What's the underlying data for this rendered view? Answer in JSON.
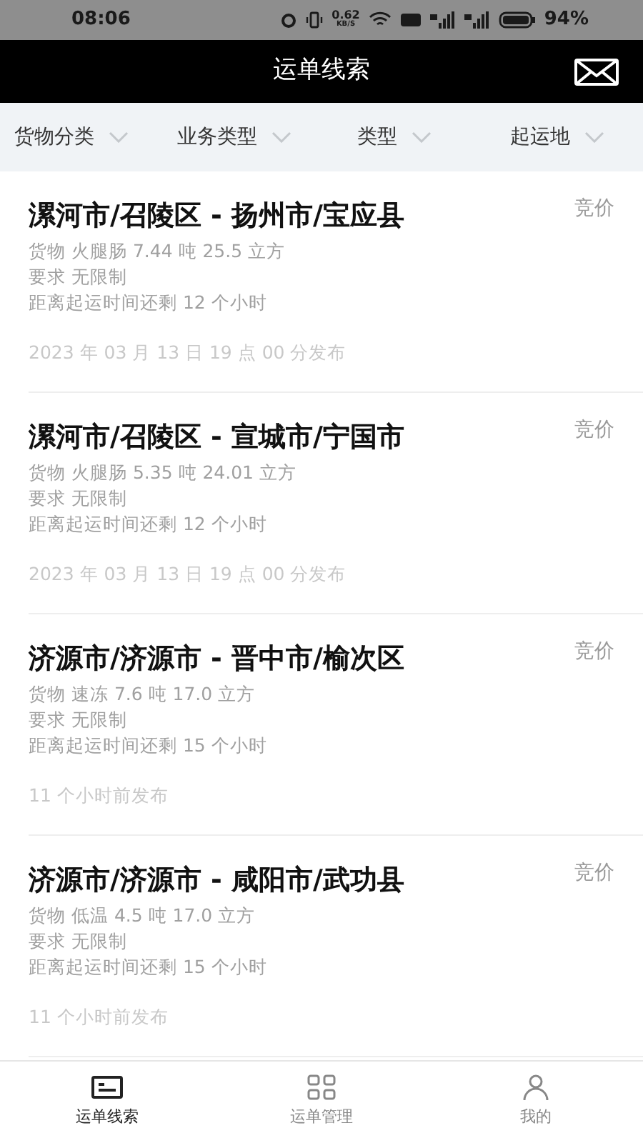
{
  "status_bar": {
    "time": "08:06",
    "net_speed": "0.62",
    "net_unit": "KB/S",
    "battery": "94%"
  },
  "header": {
    "title": "运单线索"
  },
  "filters": [
    {
      "label": "货物分类"
    },
    {
      "label": "业务类型"
    },
    {
      "label": "类型"
    },
    {
      "label": "起运地"
    }
  ],
  "orders": [
    {
      "route": "漯河市/召陵区 - 扬州市/宝应县",
      "tag": "竞价",
      "cargo": "货物 火腿肠 7.44 吨 25.5 立方",
      "requirement": "要求 无限制",
      "remaining": "距离起运时间还剩 12 个小时",
      "published": "2023 年 03 月 13 日 19 点 00 分发布"
    },
    {
      "route": "漯河市/召陵区 - 宣城市/宁国市",
      "tag": "竞价",
      "cargo": "货物 火腿肠 5.35 吨 24.01 立方",
      "requirement": "要求 无限制",
      "remaining": "距离起运时间还剩 12 个小时",
      "published": "2023 年 03 月 13 日 19 点 00 分发布"
    },
    {
      "route": "济源市/济源市 - 晋中市/榆次区",
      "tag": "竞价",
      "cargo": "货物 速冻 7.6 吨 17.0 立方",
      "requirement": "要求 无限制",
      "remaining": "距离起运时间还剩 15 个小时",
      "published": "11 个小时前发布"
    },
    {
      "route": "济源市/济源市 - 咸阳市/武功县",
      "tag": "竞价",
      "cargo": "货物 低温 4.5 吨 17.0 立方",
      "requirement": "要求 无限制",
      "remaining": "距离起运时间还剩 15 个小时",
      "published": "11 个小时前发布"
    }
  ],
  "tabs": [
    {
      "label": "运单线索",
      "kind": "leads",
      "selected": true
    },
    {
      "label": "运单管理",
      "kind": "manage",
      "selected": false
    },
    {
      "label": "我的",
      "kind": "profile",
      "selected": false
    }
  ]
}
